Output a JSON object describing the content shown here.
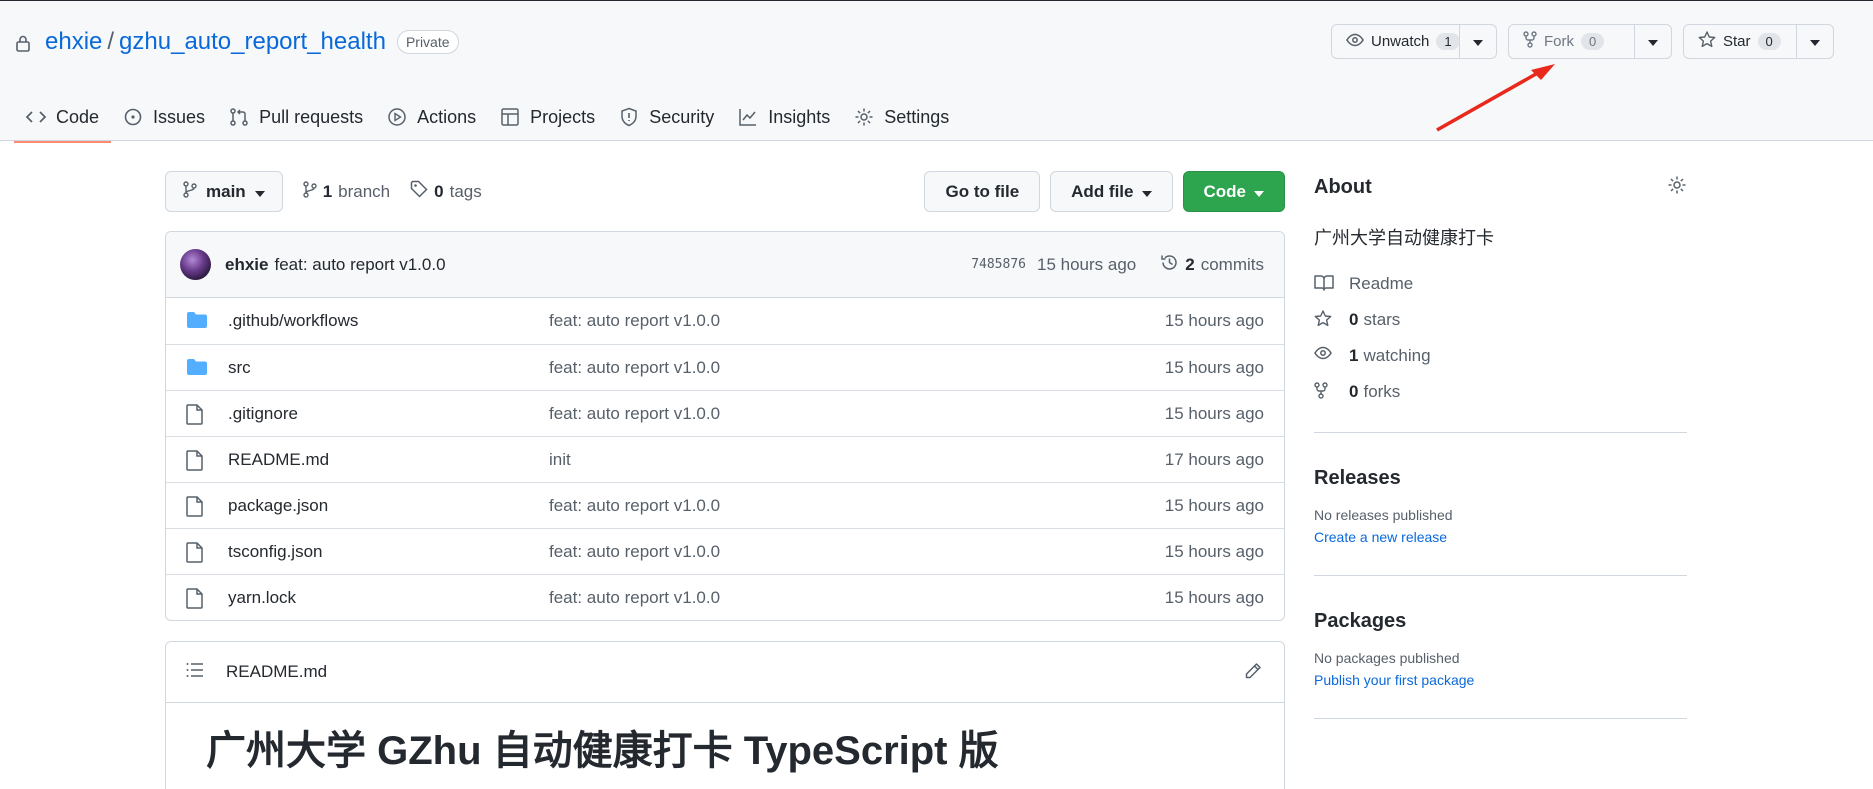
{
  "repo": {
    "owner": "ehxie",
    "separator": "/",
    "name": "gzhu_auto_report_health",
    "visibility": "Private"
  },
  "actions": {
    "unwatch": {
      "label": "Unwatch",
      "count": "1"
    },
    "fork": {
      "label": "Fork",
      "count": "0"
    },
    "star": {
      "label": "Star",
      "count": "0"
    }
  },
  "tabs": [
    {
      "label": "Code",
      "icon": "code-icon",
      "active": true
    },
    {
      "label": "Issues",
      "icon": "issue-icon"
    },
    {
      "label": "Pull requests",
      "icon": "pull-request-icon"
    },
    {
      "label": "Actions",
      "icon": "play-icon"
    },
    {
      "label": "Projects",
      "icon": "table-icon"
    },
    {
      "label": "Security",
      "icon": "shield-icon"
    },
    {
      "label": "Insights",
      "icon": "graph-icon"
    },
    {
      "label": "Settings",
      "icon": "gear-icon"
    }
  ],
  "file_nav": {
    "branch": "main",
    "branch_count": "1",
    "branch_label": "branch",
    "tag_count": "0",
    "tag_label": "tags",
    "go_to_file": "Go to file",
    "add_file": "Add file",
    "code": "Code"
  },
  "latest_commit": {
    "author": "ehxie",
    "message": "feat: auto report v1.0.0",
    "sha": "7485876",
    "time": "15 hours ago",
    "commit_count": "2",
    "commit_label": "commits"
  },
  "files": [
    {
      "type": "folder",
      "name": ".github/workflows",
      "message": "feat: auto report v1.0.0",
      "time": "15 hours ago"
    },
    {
      "type": "folder",
      "name": "src",
      "message": "feat: auto report v1.0.0",
      "time": "15 hours ago"
    },
    {
      "type": "file",
      "name": ".gitignore",
      "message": "feat: auto report v1.0.0",
      "time": "15 hours ago"
    },
    {
      "type": "file",
      "name": "README.md",
      "message": "init",
      "time": "17 hours ago"
    },
    {
      "type": "file",
      "name": "package.json",
      "message": "feat: auto report v1.0.0",
      "time": "15 hours ago"
    },
    {
      "type": "file",
      "name": "tsconfig.json",
      "message": "feat: auto report v1.0.0",
      "time": "15 hours ago"
    },
    {
      "type": "file",
      "name": "yarn.lock",
      "message": "feat: auto report v1.0.0",
      "time": "15 hours ago"
    }
  ],
  "readme": {
    "filename": "README.md",
    "heading": "广州大学 GZhu 自动健康打卡 TypeScript 版"
  },
  "sidebar": {
    "about_title": "About",
    "description": "广州大学自动健康打卡",
    "readme_label": "Readme",
    "stars_count": "0",
    "stars_label": "stars",
    "watching_count": "1",
    "watching_label": "watching",
    "forks_count": "0",
    "forks_label": "forks",
    "releases_title": "Releases",
    "releases_empty": "No releases published",
    "releases_action": "Create a new release",
    "packages_title": "Packages",
    "packages_empty": "No packages published",
    "packages_action": "Publish your first package"
  },
  "colors": {
    "accent": "#0969da",
    "code_button": "#2da44e",
    "active_tab_underline": "#fd8c73",
    "annotation_arrow": "#e8291c",
    "folder": "#54aeff"
  }
}
